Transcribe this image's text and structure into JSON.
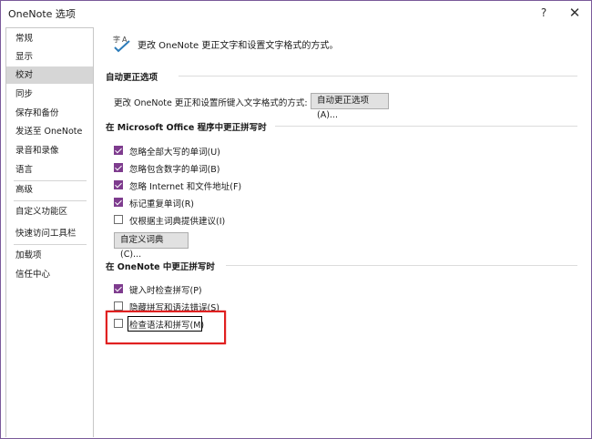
{
  "window": {
    "title": "OneNote 选项",
    "help_glyph": "?",
    "close_glyph": "✕"
  },
  "sidebar": {
    "items": [
      {
        "label": "常规",
        "selected": false
      },
      {
        "label": "显示",
        "selected": false
      },
      {
        "label": "校对",
        "selected": true
      },
      {
        "label": "同步",
        "selected": false
      },
      {
        "label": "保存和备份",
        "selected": false
      },
      {
        "label": "发送至 OneNote",
        "selected": false
      },
      {
        "label": "录音和录像",
        "selected": false
      },
      {
        "label": "语言",
        "selected": false
      },
      {
        "label": "高级",
        "selected": false
      },
      {
        "label": "自定义功能区",
        "selected": false
      },
      {
        "label": "快速访问工具栏",
        "selected": false
      },
      {
        "label": "加载项",
        "selected": false
      },
      {
        "label": "信任中心",
        "selected": false
      }
    ]
  },
  "main": {
    "header_text": "更改 OneNote 更正文字和设置文字格式的方式。",
    "header_icon": "abc-proofing-icon",
    "autocorrect": {
      "section_title": "自动更正选项",
      "description": "更改 OneNote 更正和设置所键入文字格式的方式:",
      "button_label": "自动更正选项(A)..."
    },
    "office_spelling": {
      "section_title": "在 Microsoft Office 程序中更正拼写时",
      "options": [
        {
          "label": "忽略全部大写的单词(U)",
          "checked": true
        },
        {
          "label": "忽略包含数字的单词(B)",
          "checked": true
        },
        {
          "label": "忽略 Internet 和文件地址(F)",
          "checked": true
        },
        {
          "label": "标记重复单词(R)",
          "checked": true
        },
        {
          "label": "仅根据主词典提供建议(I)",
          "checked": false
        }
      ],
      "custom_dict_button": "自定义词典(C)..."
    },
    "onenote_spelling": {
      "section_title": "在 OneNote 中更正拼写时",
      "options": [
        {
          "label": "键入时检查拼写(P)",
          "checked": true
        },
        {
          "label": "隐藏拼写和语法错误(S)",
          "checked": false
        },
        {
          "label": "检查语法和拼写(M)",
          "checked": false
        }
      ]
    }
  },
  "colors": {
    "accent": "#7e3c8e",
    "highlight": "#e02020",
    "selected_bg": "#d6d6d6"
  }
}
